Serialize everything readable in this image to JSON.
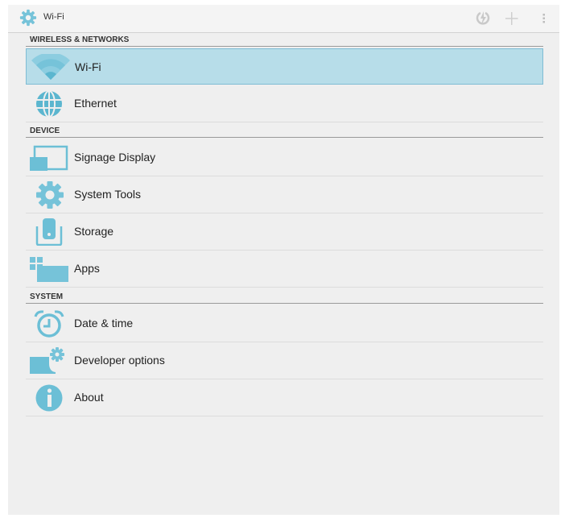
{
  "actionbar": {
    "title": "Wi-Fi",
    "app_icon": "settings-gear-icon",
    "actions": [
      "wps-icon",
      "add-network-icon",
      "overflow-menu-icon"
    ]
  },
  "sections": {
    "wireless": "WIRELESS & NETWORKS",
    "device": "DEVICE",
    "system": "SYSTEM"
  },
  "items": {
    "wifi": "Wi-Fi",
    "ethernet": "Ethernet",
    "signage": "Signage Display",
    "system_tools": "System Tools",
    "storage": "Storage",
    "apps": "Apps",
    "date_time": "Date & time",
    "developer": "Developer options",
    "about": "About"
  },
  "colors": {
    "accent": "#76c3d9",
    "selected_bg": "#b7dde9",
    "background": "#efefef"
  }
}
